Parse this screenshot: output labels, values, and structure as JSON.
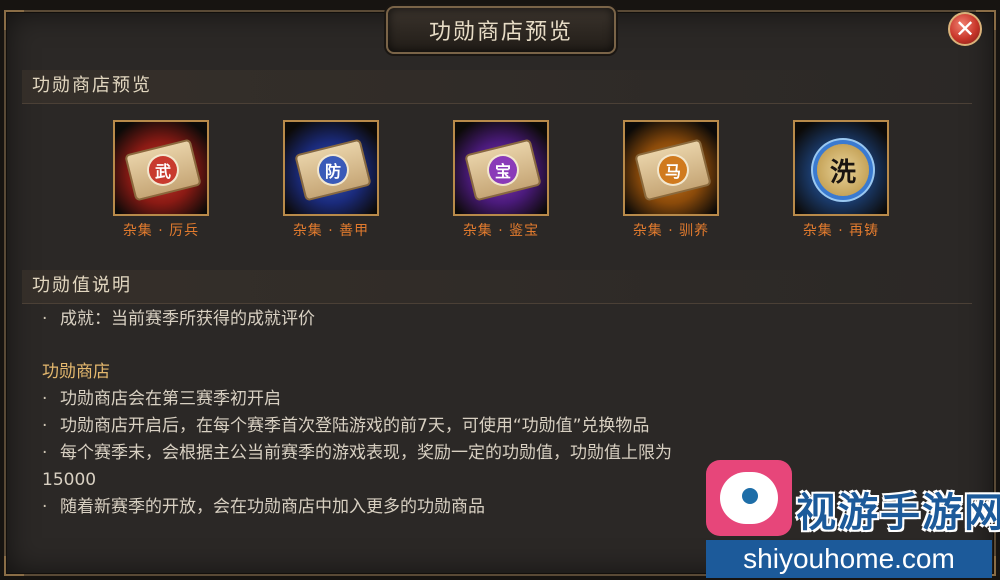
{
  "window": {
    "title": "功勋商店预览"
  },
  "close": {
    "glyph": "✕"
  },
  "shop_section": {
    "heading": "功勋商店预览",
    "items": [
      {
        "seal": "武",
        "label": "杂集 · 厉兵",
        "color": "#c83a2e",
        "glow": "#8a1a14"
      },
      {
        "seal": "防",
        "label": "杂集 · 善甲",
        "color": "#3a5ab8",
        "glow": "#1a2a7a"
      },
      {
        "seal": "宝",
        "label": "杂集 · 鉴宝",
        "color": "#8a3ab8",
        "glow": "#4a1a7a"
      },
      {
        "seal": "马",
        "label": "杂集 · 驯养",
        "color": "#d07a1e",
        "glow": "#8a4a0a"
      },
      {
        "seal": "洗",
        "label": "杂集 · 再铸",
        "color": "#2a4a7a",
        "glow": "#1a3a6a"
      }
    ]
  },
  "value_section": {
    "heading": "功勋值说明",
    "lines": [
      {
        "bullet": "·",
        "text": "成就：当前赛季所获得的成就评价"
      }
    ],
    "shop_title": "功勋商店",
    "shop_lines": [
      {
        "bullet": "·",
        "text": "功勋商店会在第三赛季初开启"
      },
      {
        "bullet": "·",
        "text": "功勋商店开启后，在每个赛季首次登陆游戏的前7天，可使用“功勋值”兑换物品"
      },
      {
        "bullet": "·",
        "text": "每个赛季末，会根据主公当前赛季的游戏表现，奖励一定的功勋值，功勋值上限为"
      },
      {
        "bullet": "",
        "text": "15000"
      },
      {
        "bullet": "·",
        "text": "随着新赛季的开放，会在功勋商店中加入更多的功勋商品"
      }
    ]
  },
  "watermark": {
    "text": "视游手游网",
    "url": "shiyouhome.com"
  }
}
